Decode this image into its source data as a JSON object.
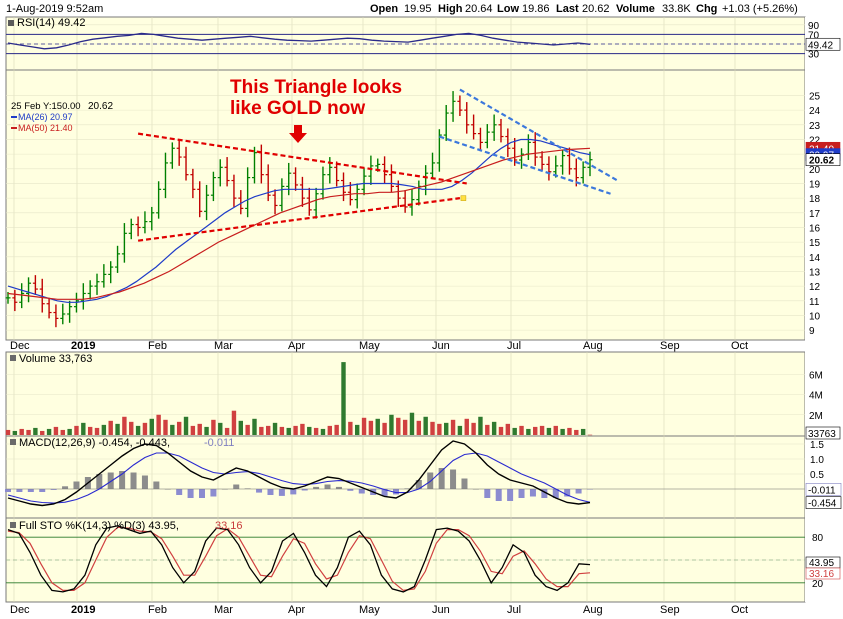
{
  "header": {
    "date": "1-Aug-2019 9:52am",
    "open_label": "Open",
    "open": "19.95",
    "high_label": "High",
    "high": "20.64",
    "low_label": "Low",
    "low": "19.86",
    "last_label": "Last",
    "last": "20.62",
    "volume_label": "Volume",
    "volume": "33.8K",
    "chg_label": "Chg",
    "chg": "+1.03 (+5.26%)"
  },
  "annotation": {
    "line1": "This Triangle looks",
    "line2": "like GOLD now"
  },
  "colors": {
    "panel_bg": "#ffffe0",
    "annotation": "#e00000",
    "up": "#008000",
    "down": "#c00000",
    "ma26": "#1f3cc8",
    "ma50": "#c81e1e",
    "trendline_red": "#e00000",
    "trendline_blue": "#3c78dc",
    "border": "#7a7a7a"
  },
  "x_labels_price": [
    "Dec",
    "2019",
    "Feb",
    "Mar",
    "Apr",
    "May",
    "Jun",
    "Jul",
    "Aug",
    "Sep",
    "Oct"
  ],
  "x_labels_bottom": [
    "Dec",
    "2019",
    "Feb",
    "Mar",
    "Apr",
    "May",
    "Jun",
    "Jul",
    "Aug",
    "Sep",
    "Oct"
  ],
  "chart_data": [
    {
      "type": "line",
      "name": "RSI(14)",
      "legend": "RSI(14) 49.42",
      "ylim": [
        0,
        100
      ],
      "ticks": [
        "90",
        "70",
        "50",
        "30"
      ],
      "last_value": "49.42",
      "levels": [
        70,
        30
      ],
      "values": [
        52,
        48,
        44,
        40,
        42,
        48,
        55,
        60,
        63,
        66,
        68,
        72,
        70,
        66,
        62,
        60,
        58,
        60,
        62,
        64,
        66,
        63,
        60,
        58,
        57,
        56,
        58,
        60,
        62,
        61,
        58,
        56,
        55,
        54,
        58,
        62,
        66,
        70,
        72,
        68,
        62,
        58,
        54,
        52,
        50,
        48,
        50,
        52,
        49.42
      ]
    },
    {
      "type": "line",
      "name": "Price",
      "legend_date": "25 Feb Y:150.00",
      "legend_last": "20.62",
      "ma26_legend": "MA(26) 20.97",
      "ma50_legend": "MA(50) 21.40",
      "ylim": [
        8.6,
        26.6
      ],
      "ticks": [
        "25",
        "24",
        "23",
        "22",
        "21",
        "20",
        "19",
        "18",
        "17",
        "16",
        "15",
        "14",
        "13",
        "12",
        "11",
        "10",
        "9"
      ],
      "right_tags": [
        "21.40",
        "20.97",
        "20.62"
      ],
      "close": [
        11.2,
        10.9,
        11.5,
        12.2,
        11.8,
        10.8,
        10.2,
        9.8,
        10.1,
        10.6,
        11.0,
        11.5,
        12.0,
        12.3,
        12.8,
        13.3,
        14.2,
        15.6,
        16.2,
        16.0,
        16.4,
        17.0,
        18.6,
        20.4,
        21.4,
        20.8,
        19.6,
        18.6,
        17.1,
        18.2,
        19.4,
        20.1,
        19.2,
        18.0,
        17.3,
        19.4,
        21.1,
        19.6,
        18.2,
        17.5,
        18.8,
        19.7,
        18.9,
        18.0,
        17.2,
        18.3,
        19.6,
        20.1,
        19.2,
        18.4,
        17.9,
        18.6,
        19.5,
        20.2,
        20.3,
        19.6,
        18.8,
        18.0,
        17.4,
        17.9,
        18.8,
        19.7,
        20.4,
        22.3,
        23.8,
        24.6,
        24.0,
        23.0,
        22.4,
        21.8,
        22.5,
        23.0,
        22.2,
        21.4,
        20.6,
        21.0,
        21.8,
        20.8,
        20.3,
        19.8,
        20.2,
        20.9,
        20.0,
        19.4,
        20.1,
        20.62
      ],
      "ma26": [
        12.0,
        11.8,
        11.6,
        11.4,
        11.2,
        11.0,
        10.9,
        10.9,
        11.0,
        11.1,
        11.3,
        11.6,
        11.9,
        12.3,
        12.8,
        13.3,
        13.9,
        14.5,
        15.0,
        15.5,
        16.0,
        16.5,
        17.0,
        17.4,
        17.8,
        18.1,
        18.3,
        18.5,
        18.6,
        18.6,
        18.6,
        18.6,
        18.6,
        18.7,
        18.8,
        18.9,
        19.0,
        19.0,
        19.0,
        19.0,
        18.9,
        18.8,
        18.6,
        18.6,
        18.6,
        18.8,
        19.2,
        19.7,
        20.3,
        20.9,
        21.4,
        21.8,
        22.0,
        22.0,
        21.9,
        21.7,
        21.5,
        21.3,
        21.1,
        20.97
      ],
      "ma50": [
        11.5,
        11.4,
        11.3,
        11.2,
        11.1,
        11.1,
        11.1,
        11.2,
        11.4,
        11.6,
        11.9,
        12.2,
        12.6,
        13.0,
        13.5,
        14.0,
        14.5,
        15.0,
        15.4,
        15.8,
        16.2,
        16.6,
        17.0,
        17.3,
        17.6,
        17.9,
        18.1,
        18.2,
        18.3,
        18.3,
        18.4,
        18.4,
        18.5,
        18.7,
        18.9,
        19.1,
        19.4,
        19.7,
        20.0,
        20.3,
        20.6,
        20.8,
        21.0,
        21.1,
        21.2,
        21.3,
        21.35,
        21.4
      ]
    },
    {
      "type": "bar",
      "name": "Volume",
      "legend": "Volume 33,763",
      "ylim": [
        0,
        8000000
      ],
      "ticks": [
        "6M",
        "4M",
        "2M"
      ],
      "last_value": "33763",
      "values": [
        0.5,
        0.4,
        0.6,
        0.5,
        0.7,
        0.4,
        0.6,
        0.8,
        0.5,
        0.6,
        0.9,
        1.2,
        0.8,
        0.7,
        1.0,
        1.4,
        1.1,
        1.8,
        1.3,
        0.9,
        1.2,
        1.6,
        2.0,
        1.5,
        1.0,
        1.3,
        1.8,
        0.9,
        1.1,
        0.8,
        1.5,
        1.2,
        0.7,
        2.4,
        1.4,
        1.0,
        1.6,
        0.8,
        0.9,
        1.2,
        0.8,
        0.7,
        0.9,
        1.1,
        0.8,
        0.7,
        0.6,
        0.9,
        1.0,
        7.2,
        1.3,
        1.0,
        1.7,
        1.4,
        1.6,
        1.2,
        2.0,
        1.7,
        1.5,
        2.2,
        1.4,
        1.8,
        1.3,
        1.1,
        1.2,
        1.5,
        0.9,
        1.6,
        1.2,
        1.8,
        1.0,
        1.3,
        0.8,
        1.1,
        0.7,
        0.9,
        0.6,
        0.8,
        0.9,
        0.7,
        0.9,
        0.6,
        0.7,
        0.5,
        0.6,
        0.03
      ]
    },
    {
      "type": "line",
      "name": "MACD",
      "legend_main": "MACD(12,26,9) -0.454, -0.443,",
      "legend_hist": "-0.011",
      "ylim": [
        -0.9,
        1.7
      ],
      "ticks": [
        "1.5",
        "1.0",
        "0.5",
        "0.0"
      ],
      "right_tags": [
        "-0.011",
        "-0.454"
      ],
      "macd": [
        -0.3,
        -0.4,
        -0.5,
        -0.55,
        -0.5,
        -0.35,
        -0.1,
        0.2,
        0.5,
        0.8,
        1.1,
        1.35,
        1.5,
        1.45,
        1.2,
        0.9,
        0.6,
        0.4,
        0.3,
        0.5,
        0.7,
        0.6,
        0.4,
        0.2,
        0.05,
        0.0,
        0.1,
        0.25,
        0.4,
        0.35,
        0.2,
        0.05,
        -0.1,
        -0.25,
        -0.3,
        -0.1,
        0.3,
        0.8,
        1.3,
        1.6,
        1.5,
        1.2,
        0.8,
        0.5,
        0.3,
        0.2,
        0.1,
        -0.1,
        -0.3,
        -0.45,
        -0.5,
        -0.454
      ],
      "signal": [
        -0.2,
        -0.3,
        -0.4,
        -0.45,
        -0.47,
        -0.44,
        -0.35,
        -0.2,
        0.0,
        0.25,
        0.5,
        0.8,
        1.05,
        1.2,
        1.2,
        1.1,
        0.9,
        0.7,
        0.55,
        0.5,
        0.55,
        0.58,
        0.52,
        0.4,
        0.28,
        0.18,
        0.15,
        0.18,
        0.25,
        0.28,
        0.26,
        0.2,
        0.1,
        -0.02,
        -0.12,
        -0.12,
        0.0,
        0.25,
        0.6,
        0.95,
        1.15,
        1.2,
        1.1,
        0.9,
        0.7,
        0.5,
        0.35,
        0.2,
        0.0,
        -0.2,
        -0.35,
        -0.443
      ]
    },
    {
      "type": "line",
      "name": "Full STO",
      "legend_main": "Full STO %K(14,3) %D(3) 43.95,",
      "legend_d": "33.16",
      "ylim": [
        0,
        100
      ],
      "ticks": [
        "80",
        "50",
        "20"
      ],
      "levels": [
        80,
        20
      ],
      "right_tags": [
        "43.95",
        "33.16"
      ],
      "k": [
        90,
        85,
        60,
        30,
        10,
        8,
        12,
        30,
        70,
        92,
        95,
        90,
        85,
        88,
        70,
        40,
        20,
        35,
        75,
        92,
        90,
        70,
        40,
        20,
        35,
        75,
        85,
        60,
        30,
        15,
        40,
        80,
        88,
        70,
        30,
        12,
        8,
        15,
        50,
        90,
        92,
        88,
        75,
        50,
        20,
        40,
        70,
        60,
        30,
        15,
        10,
        20,
        45,
        43.95
      ],
      "d": [
        88,
        86,
        72,
        45,
        20,
        10,
        10,
        20,
        50,
        80,
        93,
        92,
        88,
        87,
        78,
        55,
        30,
        30,
        55,
        82,
        91,
        80,
        55,
        30,
        28,
        55,
        78,
        72,
        45,
        25,
        30,
        60,
        82,
        78,
        50,
        22,
        10,
        12,
        35,
        72,
        90,
        90,
        82,
        62,
        35,
        32,
        55,
        62,
        45,
        25,
        15,
        15,
        32,
        33.16
      ]
    }
  ]
}
